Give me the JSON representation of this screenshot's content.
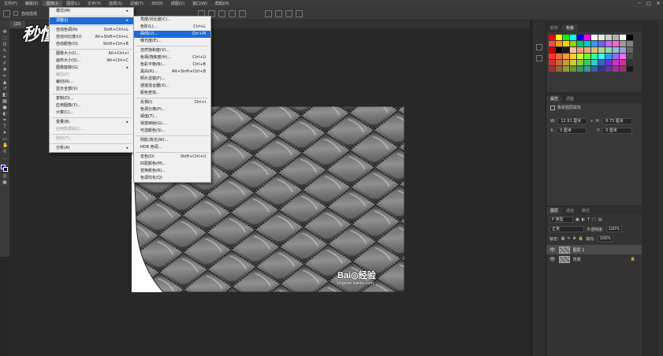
{
  "menubar": {
    "items": [
      "文件(F)",
      "编辑(E)",
      "图像(I)",
      "图层(L)",
      "文字(Y)",
      "选择(S)",
      "滤镜(T)",
      "3D(D)",
      "视图(V)",
      "窗口(W)",
      "帮助(H)"
    ],
    "active_index": 2
  },
  "window_controls": [
    "─",
    "□",
    "✕"
  ],
  "options_bar": {
    "auto_select_label": "自动选择"
  },
  "document": {
    "tab_label": "JZ9"
  },
  "overlay_watermark": "秒懂视频",
  "photo_watermark": {
    "brand": "Bai◎经验",
    "url": "jingyan.baidu.com"
  },
  "image_menu": {
    "items": [
      {
        "label": "模式(M)",
        "shortcut": "",
        "submenu": true
      },
      {
        "sep": true
      },
      {
        "label": "调整(J)",
        "shortcut": "",
        "submenu": true,
        "highlight": true
      },
      {
        "sep": true
      },
      {
        "label": "自动色调(N)",
        "shortcut": "Shift+Ctrl+L"
      },
      {
        "label": "自动对比度(U)",
        "shortcut": "Alt+Shift+Ctrl+L"
      },
      {
        "label": "自动颜色(O)",
        "shortcut": "Shift+Ctrl+B"
      },
      {
        "sep": true
      },
      {
        "label": "图像大小(I)...",
        "shortcut": "Alt+Ctrl+I"
      },
      {
        "label": "画布大小(S)...",
        "shortcut": "Alt+Ctrl+C"
      },
      {
        "label": "图像旋转(G)",
        "shortcut": "",
        "submenu": true
      },
      {
        "label": "裁剪(P)",
        "shortcut": "",
        "disabled": true
      },
      {
        "label": "裁切(R)...",
        "shortcut": ""
      },
      {
        "label": "显示全部(V)",
        "shortcut": ""
      },
      {
        "sep": true
      },
      {
        "label": "复制(D)...",
        "shortcut": ""
      },
      {
        "label": "应用图像(Y)...",
        "shortcut": ""
      },
      {
        "label": "计算(C)...",
        "shortcut": ""
      },
      {
        "sep": true
      },
      {
        "label": "变量(B)",
        "shortcut": "",
        "submenu": true
      },
      {
        "label": "应用数据组(L)...",
        "shortcut": "",
        "disabled": true
      },
      {
        "sep": true
      },
      {
        "label": "陷印(T)...",
        "shortcut": "",
        "disabled": true
      },
      {
        "sep": true
      },
      {
        "label": "分析(A)",
        "shortcut": "",
        "submenu": true
      }
    ]
  },
  "adjust_menu": {
    "items": [
      {
        "label": "亮度/对比度(C)...",
        "shortcut": ""
      },
      {
        "label": "色阶(L)...",
        "shortcut": "Ctrl+L"
      },
      {
        "label": "曲线(U)...",
        "shortcut": "Ctrl+M",
        "highlight": true
      },
      {
        "label": "曝光度(E)...",
        "shortcut": ""
      },
      {
        "sep": true
      },
      {
        "label": "自然饱和度(V)...",
        "shortcut": ""
      },
      {
        "label": "色相/饱和度(H)...",
        "shortcut": "Ctrl+U"
      },
      {
        "label": "色彩平衡(B)...",
        "shortcut": "Ctrl+B"
      },
      {
        "label": "黑白(K)...",
        "shortcut": "Alt+Shift+Ctrl+B"
      },
      {
        "label": "照片滤镜(F)...",
        "shortcut": ""
      },
      {
        "label": "通道混合器(X)...",
        "shortcut": ""
      },
      {
        "label": "颜色查找...",
        "shortcut": ""
      },
      {
        "sep": true
      },
      {
        "label": "反相(I)",
        "shortcut": "Ctrl+I"
      },
      {
        "label": "色调分离(P)...",
        "shortcut": ""
      },
      {
        "label": "阈值(T)...",
        "shortcut": ""
      },
      {
        "label": "渐变映射(G)...",
        "shortcut": ""
      },
      {
        "label": "可选颜色(S)...",
        "shortcut": ""
      },
      {
        "sep": true
      },
      {
        "label": "阴影/高光(W)...",
        "shortcut": ""
      },
      {
        "label": "HDR 色调...",
        "shortcut": ""
      },
      {
        "sep": true
      },
      {
        "label": "去色(D)",
        "shortcut": "Shift+Ctrl+U"
      },
      {
        "label": "匹配颜色(M)...",
        "shortcut": ""
      },
      {
        "label": "替换颜色(R)...",
        "shortcut": ""
      },
      {
        "label": "色调均化(Q)",
        "shortcut": ""
      }
    ]
  },
  "swatch_panel": {
    "tabs": [
      "颜色",
      "色板"
    ],
    "active_tab": 1,
    "colors": [
      "#ff0000",
      "#ffff00",
      "#00ff00",
      "#00ffff",
      "#0000ff",
      "#ff00ff",
      "#ffffff",
      "#e6e6e6",
      "#cccccc",
      "#b3b3b3",
      "#ffffff",
      "#000000",
      "#ff4d4d",
      "#ff9900",
      "#ffcc00",
      "#99cc00",
      "#00cc66",
      "#00cccc",
      "#3399ff",
      "#6666ff",
      "#cc66ff",
      "#ff66cc",
      "#999999",
      "#808080",
      "#cc0000",
      "#000000",
      "#1a1a1a",
      "#f2c2a0",
      "#f2a07a",
      "#e6b27a",
      "#d9c27a",
      "#b3d98c",
      "#8cd9b3",
      "#8cc2d9",
      "#a0a0d9",
      "#666666",
      "#ff3333",
      "#ff6633",
      "#ff9933",
      "#ffcc33",
      "#ccff33",
      "#66ff33",
      "#33ff99",
      "#33ffff",
      "#3399ff",
      "#9966ff",
      "#ff66ff",
      "#4d4d4d",
      "#cc3333",
      "#cc6633",
      "#cc9933",
      "#cccc33",
      "#99cc33",
      "#33cc66",
      "#33cccc",
      "#3366cc",
      "#6633cc",
      "#cc33cc",
      "#cc3399",
      "#333333",
      "#993333",
      "#996633",
      "#999933",
      "#669933",
      "#339966",
      "#339999",
      "#336699",
      "#333399",
      "#663399",
      "#993399",
      "#993366",
      "#1a1a1a"
    ]
  },
  "properties_panel": {
    "tabs": [
      "属性",
      "调整"
    ],
    "title": "像素图层属性",
    "w_label": "W:",
    "w_value": "12.91 厘米",
    "h_label": "H:",
    "h_value": "8.73 厘米",
    "x_label": "X:",
    "x_value": "0 厘米",
    "y_label": "Y:",
    "y_value": "0 厘米"
  },
  "layers_panel": {
    "tabs": [
      "图层",
      "通道",
      "路径"
    ],
    "filter_label": "P 类型",
    "blend_mode": "正常",
    "opacity_label": "不透明度:",
    "opacity_value": "100%",
    "lock_label": "锁定:",
    "fill_label": "填充:",
    "fill_value": "100%",
    "layers": [
      {
        "name": "图层 1",
        "selected": true
      },
      {
        "name": "背景",
        "selected": false
      }
    ]
  }
}
